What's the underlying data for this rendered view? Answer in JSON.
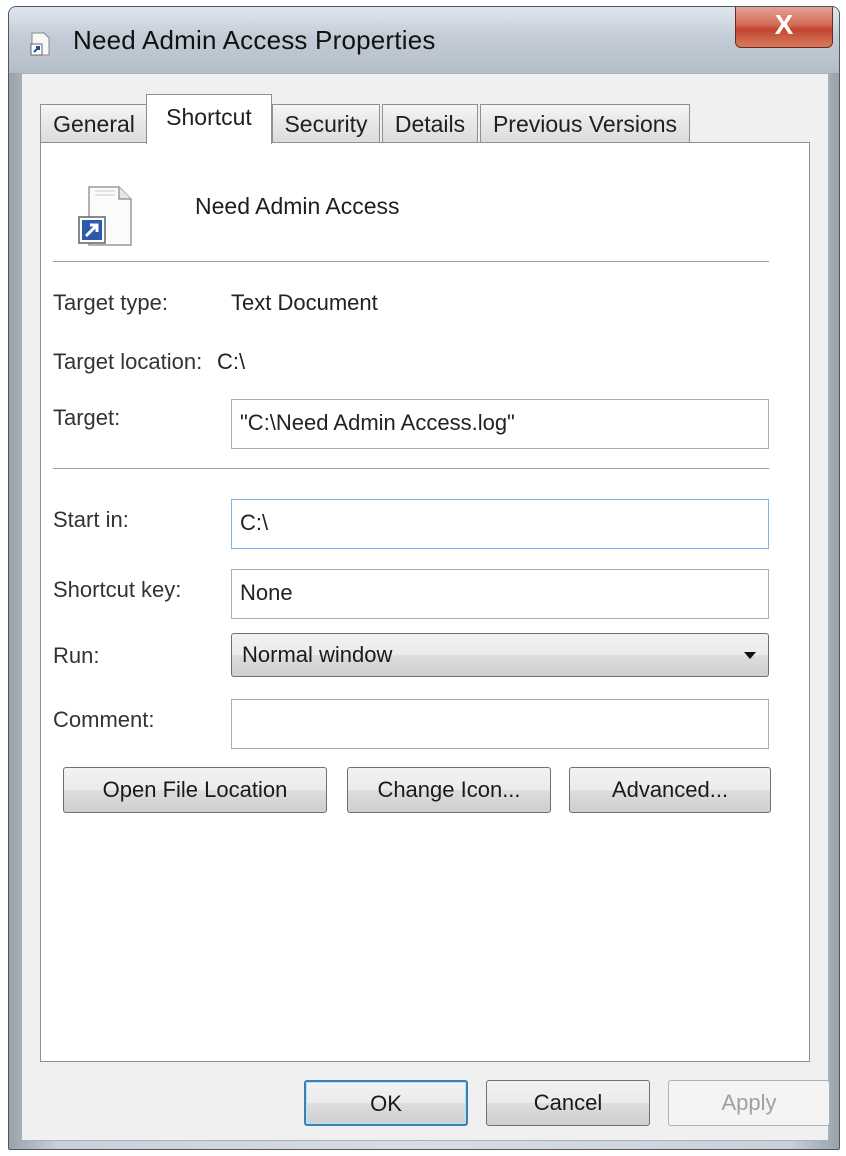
{
  "window": {
    "title": "Need Admin Access Properties",
    "close_label": "X"
  },
  "tabs": [
    {
      "label": "General",
      "active": false
    },
    {
      "label": "Shortcut",
      "active": true
    },
    {
      "label": "Security",
      "active": false
    },
    {
      "label": "Details",
      "active": false
    },
    {
      "label": "Previous Versions",
      "active": false
    }
  ],
  "shortcut": {
    "file_name": "Need Admin Access",
    "target_type_label": "Target type:",
    "target_type_value": "Text Document",
    "target_location_label": "Target location:",
    "target_location_value": "C:\\",
    "target_label": "Target:",
    "target_value": "\"C:\\Need Admin Access.log\"",
    "start_in_label": "Start in:",
    "start_in_value": "C:\\",
    "shortcut_key_label": "Shortcut key:",
    "shortcut_key_value": "None",
    "run_label": "Run:",
    "run_value": "Normal window",
    "comment_label": "Comment:",
    "comment_value": "",
    "open_file_location_label": "Open File Location",
    "change_icon_label": "Change Icon...",
    "advanced_label": "Advanced..."
  },
  "footer": {
    "ok_label": "OK",
    "cancel_label": "Cancel",
    "apply_label": "Apply"
  }
}
